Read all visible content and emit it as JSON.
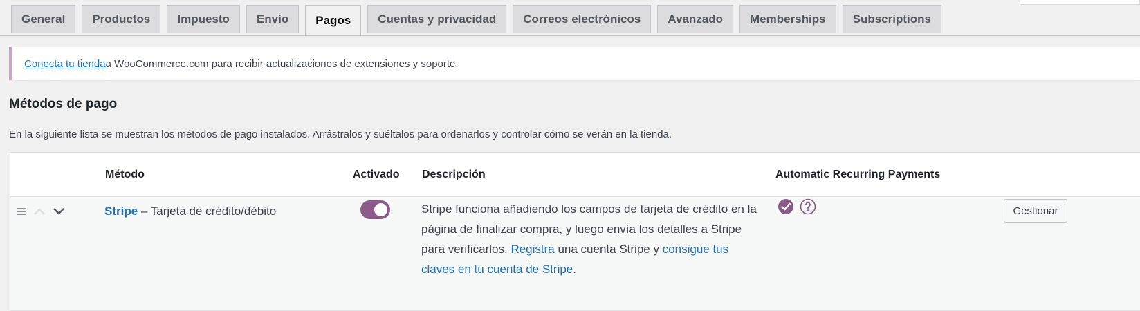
{
  "tabs": [
    {
      "label": "General"
    },
    {
      "label": "Productos"
    },
    {
      "label": "Impuesto"
    },
    {
      "label": "Envío"
    },
    {
      "label": "Pagos",
      "active": true
    },
    {
      "label": "Cuentas y privacidad"
    },
    {
      "label": "Correos electrónicos"
    },
    {
      "label": "Avanzado"
    },
    {
      "label": "Memberships"
    },
    {
      "label": "Subscriptions"
    }
  ],
  "notice": {
    "link": "Conecta tu tienda",
    "text": " a WooCommerce.com para recibir actualizaciones de extensiones y soporte."
  },
  "section": {
    "title": "Métodos de pago",
    "description": "En la siguiente lista se muestran los métodos de pago instalados. Arrástralos y suéltalos para ordenarlos y controlar cómo se verán en la tienda."
  },
  "table": {
    "headers": {
      "method": "Método",
      "enabled": "Activado",
      "description": "Descripción",
      "arp": "Automatic Recurring Payments"
    },
    "rows": [
      {
        "name": "Stripe",
        "subtitle": " – Tarjeta de crédito/débito",
        "enabled": true,
        "desc_text1": "Stripe funciona añadiendo los campos de tarjeta de crédito en la página de finalizar compra, y luego envía los detalles a Stripe para verificarlos. ",
        "desc_link1": "Registra",
        "desc_text2": " una cuenta Stripe y ",
        "desc_link2": "consigue tus claves en tu cuenta de Stripe",
        "desc_text3": ".",
        "manage_label": "Gestionar"
      }
    ]
  },
  "colors": {
    "accent": "#8c5a88",
    "link": "#2271b1"
  }
}
